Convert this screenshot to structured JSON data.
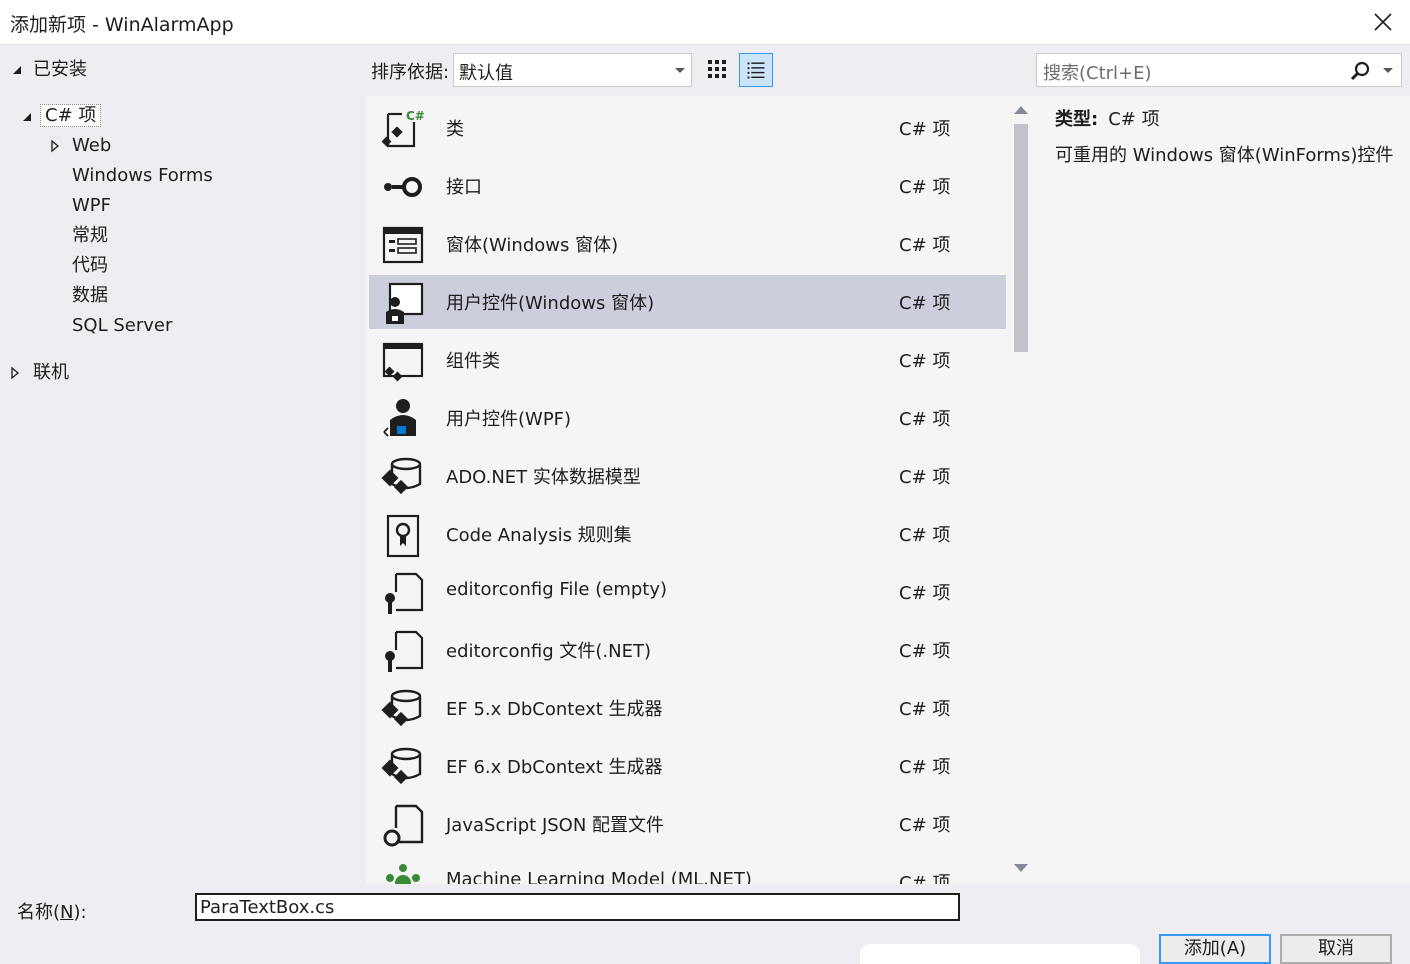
{
  "window": {
    "title": "添加新项 - WinAlarmApp"
  },
  "tree": {
    "installed_label": "已安装",
    "csharp_label": "C# 项",
    "children": [
      "Web",
      "Windows Forms",
      "WPF",
      "常规",
      "代码",
      "数据",
      "SQL Server"
    ],
    "online_label": "联机"
  },
  "toolbar": {
    "sort_label": "排序依据:",
    "sort_value": "默认值"
  },
  "search": {
    "placeholder": "搜索(Ctrl+E)"
  },
  "items": [
    {
      "name": "类",
      "type": "C# 项",
      "icon": "class-icon"
    },
    {
      "name": "接口",
      "type": "C# 项",
      "icon": "interface-icon"
    },
    {
      "name": "窗体(Windows 窗体)",
      "type": "C# 项",
      "icon": "windows-form-icon"
    },
    {
      "name": "用户控件(Windows 窗体)",
      "type": "C# 项",
      "icon": "user-control-icon",
      "selected": true
    },
    {
      "name": "组件类",
      "type": "C# 项",
      "icon": "component-class-icon"
    },
    {
      "name": "用户控件(WPF)",
      "type": "C# 项",
      "icon": "wpf-user-control-icon"
    },
    {
      "name": "ADO.NET 实体数据模型",
      "type": "C# 项",
      "icon": "entity-model-icon"
    },
    {
      "name": "Code Analysis 规则集",
      "type": "C# 项",
      "icon": "ruleset-icon"
    },
    {
      "name": "editorconfig File (empty)",
      "type": "C# 项",
      "icon": "editorconfig-icon"
    },
    {
      "name": "editorconfig 文件(.NET)",
      "type": "C# 项",
      "icon": "editorconfig-icon"
    },
    {
      "name": "EF 5.x DbContext 生成器",
      "type": "C# 项",
      "icon": "ef-generator-icon"
    },
    {
      "name": "EF 6.x DbContext 生成器",
      "type": "C# 项",
      "icon": "ef-generator-icon"
    },
    {
      "name": "JavaScript JSON 配置文件",
      "type": "C# 项",
      "icon": "json-config-icon"
    },
    {
      "name": "Machine Learning Model (ML.NET)",
      "type": "C# 项",
      "icon": "ml-model-icon"
    }
  ],
  "details": {
    "type_label": "类型:",
    "type_value": "C# 项",
    "description": "可重用的 Windows 窗体(WinForms)控件"
  },
  "footer": {
    "name_label": "名称(",
    "name_mnemonic": "N",
    "name_label_end": "):",
    "name_value": "ParaTextBox.cs",
    "add_label": "添加(A)",
    "cancel_label": "取消"
  },
  "colors": {
    "selection": "#cccedb",
    "accent": "#3399ff",
    "csharp_green": "#388a34"
  }
}
